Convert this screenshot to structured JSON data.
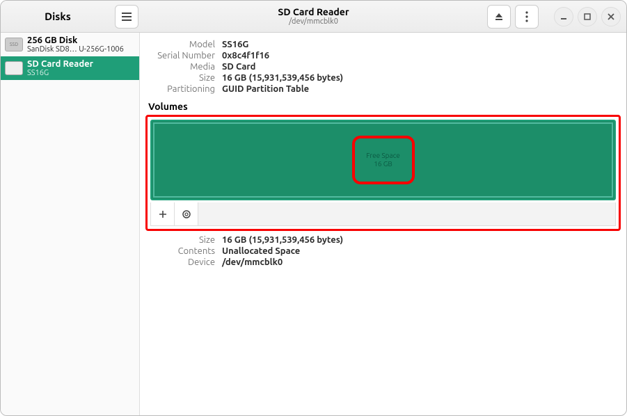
{
  "titlebar": {
    "left_title": "Disks",
    "device_title": "SD Card Reader",
    "device_path": "/dev/mmcblk0"
  },
  "sidebar": {
    "items": [
      {
        "name": "256 GB Disk",
        "sub": "SanDisk SD8…  U-256G-1006",
        "icon": "SSD"
      },
      {
        "name": "SD Card Reader",
        "sub": "SS16G",
        "icon": ""
      }
    ]
  },
  "drive_info": {
    "model_label": "Model",
    "model": "SS16G",
    "serial_label": "Serial Number",
    "serial": "0x8c4f1f16",
    "media_label": "Media",
    "media": "SD Card",
    "size_label": "Size",
    "size": "16 GB (15,931,539,456 bytes)",
    "part_label": "Partitioning",
    "part": "GUID Partition Table"
  },
  "volumes": {
    "heading": "Volumes",
    "block_label1": "Free Space",
    "block_label2": "16 GB"
  },
  "vol_info": {
    "size_label": "Size",
    "size": "16 GB (15,931,539,456 bytes)",
    "contents_label": "Contents",
    "contents": "Unallocated Space",
    "device_label": "Device",
    "device": "/dev/mmcblk0"
  }
}
